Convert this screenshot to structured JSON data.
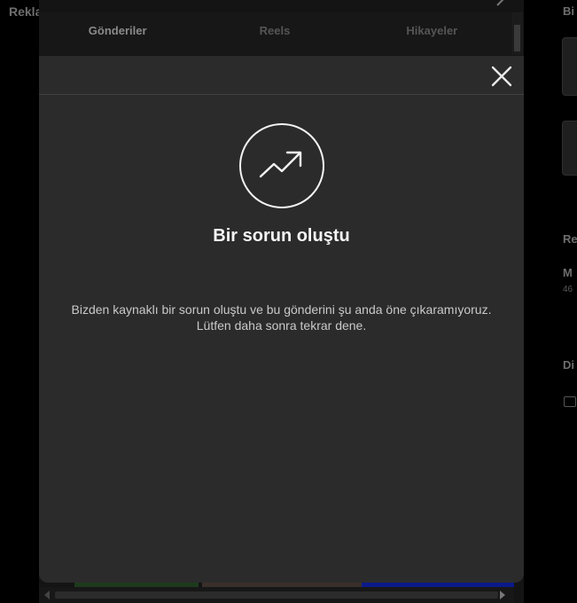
{
  "background": {
    "left_label": "Rekla",
    "right_labels": [
      "Bi",
      "Re",
      "M",
      "46",
      "Di"
    ]
  },
  "posts_picker": {
    "tabs": [
      {
        "label": "Gönderiler",
        "active": true
      },
      {
        "label": "Reels",
        "active": false
      },
      {
        "label": "Hikayeler",
        "active": false
      }
    ]
  },
  "error_dialog": {
    "icon": "trending-up-icon",
    "title": "Bir sorun oluştu",
    "message_line1": "Bizden kaynaklı bir sorun oluştu ve bu gönderini şu anda öne çıkaramıyoruz.",
    "message_line2": "Lütfen daha sonra tekrar dene.",
    "close_icon": "close-icon"
  },
  "colors": {
    "dialog_bg": "#2b2b2b",
    "overlay_bg": "#000000",
    "text_primary": "#f5f5f5",
    "text_secondary": "#c9c9c9"
  }
}
